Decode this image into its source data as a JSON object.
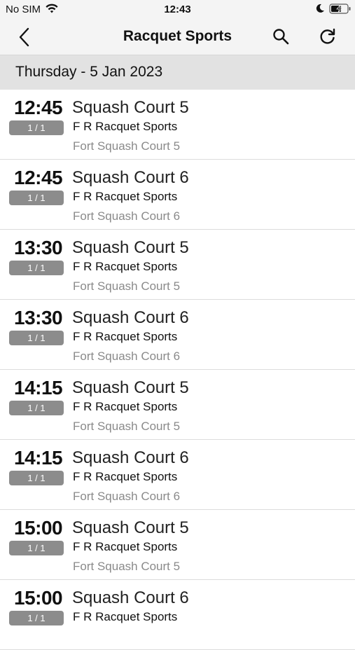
{
  "status_bar": {
    "carrier": "No SIM",
    "time": "12:43",
    "icons": [
      "wifi-icon",
      "moon-icon",
      "battery-charging-icon"
    ]
  },
  "nav": {
    "title": "Racquet Sports",
    "back_icon": "chevron-left-icon",
    "search_icon": "search-icon",
    "refresh_icon": "refresh-icon"
  },
  "date_header": "Thursday - 5 Jan 2023",
  "colors": {
    "nav_bg": "#f4f4f4",
    "date_header_bg": "#e2e2e2",
    "badge_bg": "#8c8c8c",
    "location_text": "#8a8a8a"
  },
  "slots": [
    {
      "time": "12:45",
      "badge": "1 / 1",
      "court": "Squash Court 5",
      "provider": "F R Racquet Sports",
      "location": "Fort Squash Court 5"
    },
    {
      "time": "12:45",
      "badge": "1 / 1",
      "court": "Squash Court 6",
      "provider": "F R Racquet Sports",
      "location": "Fort Squash Court 6"
    },
    {
      "time": "13:30",
      "badge": "1 / 1",
      "court": "Squash Court 5",
      "provider": "F R Racquet Sports",
      "location": "Fort Squash Court 5"
    },
    {
      "time": "13:30",
      "badge": "1 / 1",
      "court": "Squash Court 6",
      "provider": "F R Racquet Sports",
      "location": "Fort Squash Court 6"
    },
    {
      "time": "14:15",
      "badge": "1 / 1",
      "court": "Squash Court 5",
      "provider": "F R Racquet Sports",
      "location": "Fort Squash Court 5"
    },
    {
      "time": "14:15",
      "badge": "1 / 1",
      "court": "Squash Court 6",
      "provider": "F R Racquet Sports",
      "location": "Fort Squash Court 6"
    },
    {
      "time": "15:00",
      "badge": "1 / 1",
      "court": "Squash Court 5",
      "provider": "F R Racquet Sports",
      "location": "Fort Squash Court 5"
    },
    {
      "time": "15:00",
      "badge": "1 / 1",
      "court": "Squash Court 6",
      "provider": "F R Racquet Sports",
      "location": ""
    }
  ]
}
